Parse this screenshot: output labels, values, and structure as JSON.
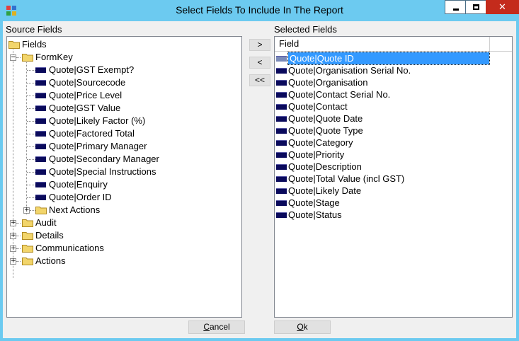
{
  "window": {
    "title": "Select Fields To Include In The Report",
    "controls": {
      "minimize": "—",
      "maximize": "□",
      "close": "✕"
    }
  },
  "source": {
    "label": "Source Fields",
    "root": "Fields",
    "formkey": "FormKey",
    "formkey_items": [
      "Quote|GST Exempt?",
      "Quote|Sourcecode",
      "Quote|Price Level",
      "Quote|GST Value",
      "Quote|Likely Factor (%)",
      "Quote|Factored Total",
      "Quote|Primary Manager",
      "Quote|Secondary Manager",
      "Quote|Special Instructions",
      "Quote|Enquiry",
      "Quote|Order ID"
    ],
    "next_actions": "Next Actions",
    "top_folders": [
      "Audit",
      "Details",
      "Communications",
      "Actions"
    ]
  },
  "buttons": {
    "add": ">",
    "remove": "<",
    "remove_all": "<<",
    "cancel_u": "C",
    "cancel_rest": "ancel",
    "ok_u": "O",
    "ok_rest": "k"
  },
  "selected": {
    "label": "Selected Fields",
    "column_header": "Field",
    "rows": [
      "Quote|Quote ID",
      "Quote|Organisation Serial No.",
      "Quote|Organisation",
      "Quote|Contact Serial No.",
      "Quote|Contact",
      "Quote|Quote Date",
      "Quote|Quote Type",
      "Quote|Category",
      "Quote|Priority",
      "Quote|Description",
      "Quote|Total Value (incl GST)",
      "Quote|Likely Date",
      "Quote|Stage",
      "Quote|Status"
    ],
    "selected_index": 0
  },
  "colors": {
    "titlebar": "#6ccaf0",
    "close": "#c42b1c",
    "selection": "#3399ff",
    "field_icon": "#0a0a5c",
    "folder": "#f2d56b"
  }
}
